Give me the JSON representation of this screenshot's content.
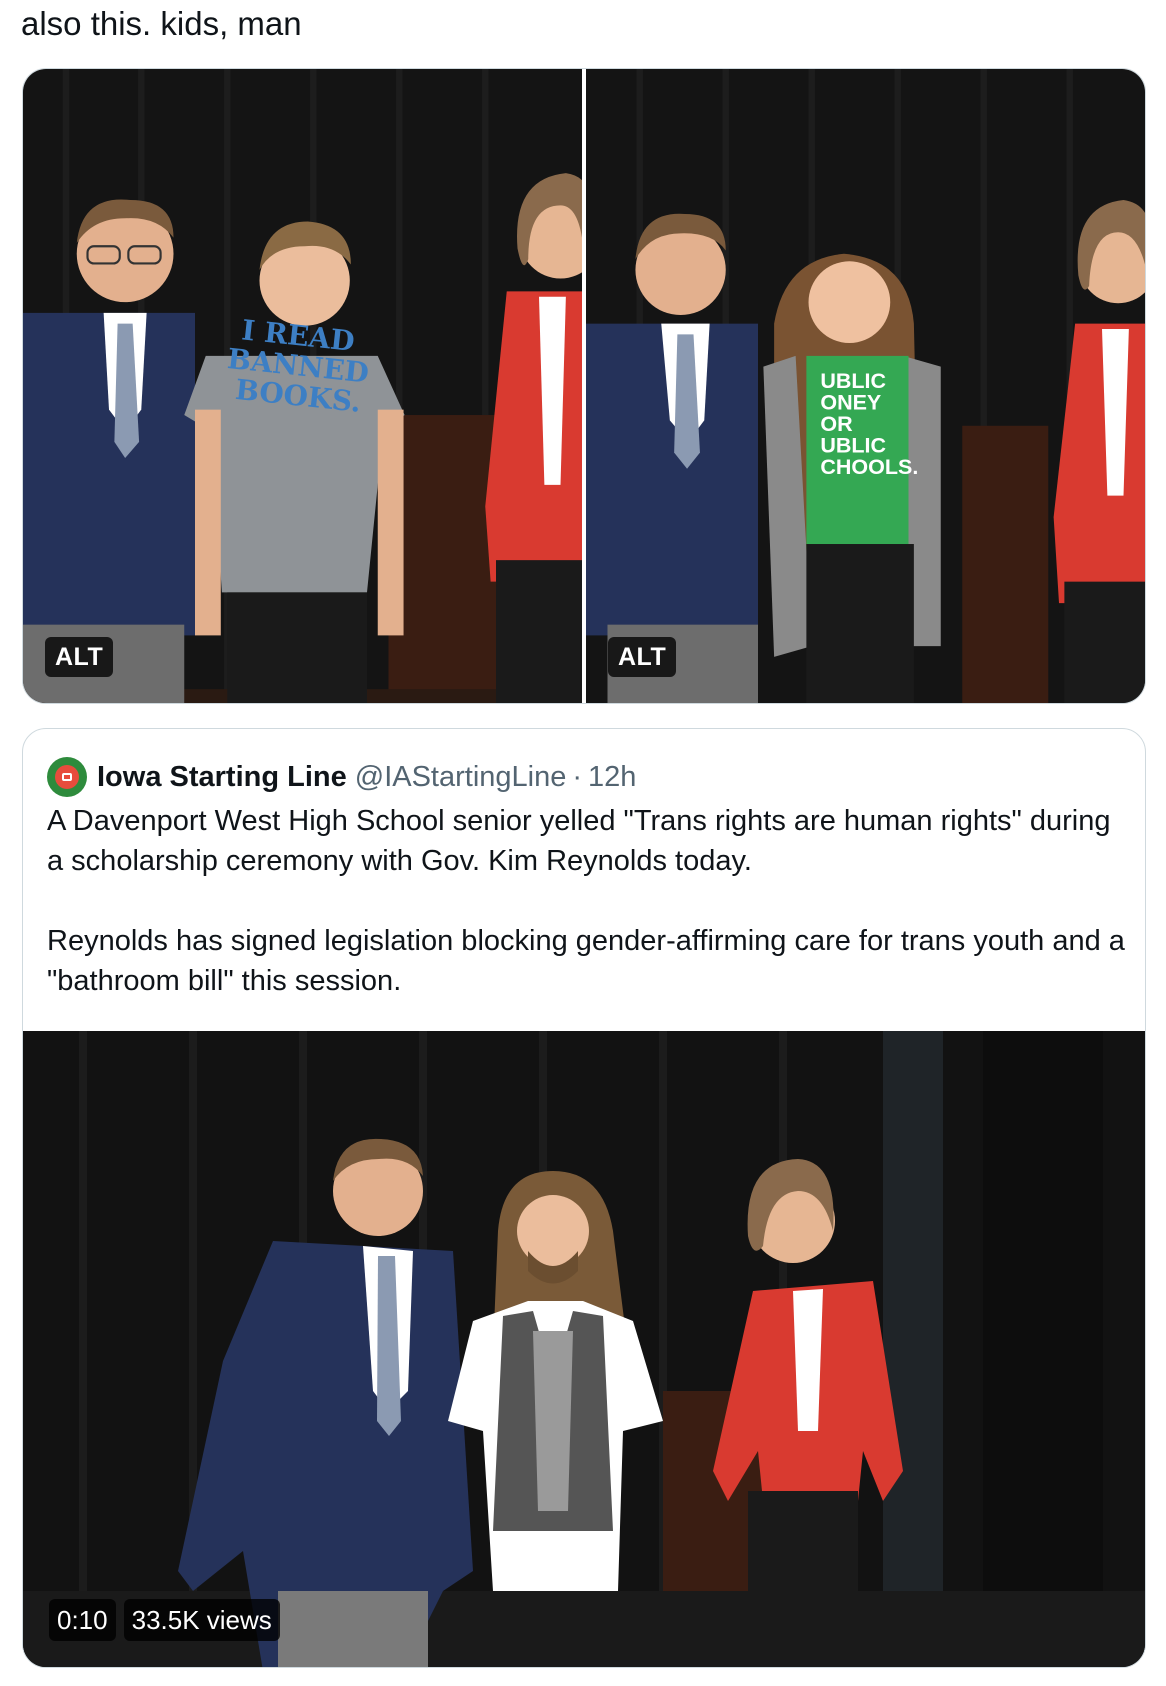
{
  "tweet": {
    "text": "also this. kids, man"
  },
  "media": {
    "alt_label_1": "ALT",
    "alt_label_2": "ALT",
    "shirt_text_1": [
      "I READ",
      "BANNED",
      "BOOKS."
    ],
    "shirt_text_2": [
      "UBLIC",
      "ONEY",
      "OR",
      "UBLIC",
      "CHOOLS."
    ]
  },
  "quote": {
    "name": "Iowa Starting Line",
    "handle": "@IAStartingLine",
    "separator": "·",
    "time": "12h",
    "paragraph_1": "A Davenport West High School senior yelled \"Trans rights are human rights\" during a scholarship ceremony with Gov. Kim Reynolds today.",
    "paragraph_2": "Reynolds has signed legislation blocking gender-affirming care for trans youth and a \"bathroom bill\" this session.",
    "video_duration": "0:10",
    "video_views": "33.5K views"
  },
  "colors": {
    "text": "#0f1419",
    "secondary_text": "#536471",
    "border": "#cfd9de",
    "avatar_green": "#2e8b3c",
    "avatar_red": "#e74c3c",
    "blazer_red": "#d93a30",
    "suit_navy": "#25325a",
    "shirt_gray": "#8f9397",
    "shirt_green": "#34a853"
  }
}
